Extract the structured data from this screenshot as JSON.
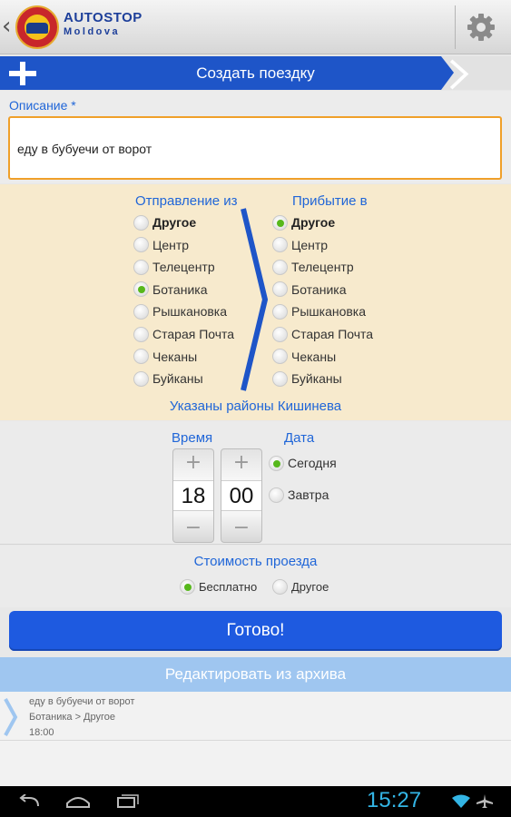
{
  "header": {
    "brand_line1": "AUTOSTOP",
    "brand_line2": "Moldova",
    "back_icon": "chevron-left-icon",
    "settings_icon": "gear-icon"
  },
  "create": {
    "title": "Создать поездку",
    "icon": "plus-icon"
  },
  "description": {
    "label": "Описание *",
    "value": "еду в бубуечи от ворот"
  },
  "departure": {
    "heading": "Отправление из",
    "selected": "Ботаника",
    "options": [
      "Другое",
      "Центр",
      "Телецентр",
      "Ботаника",
      "Рышкановка",
      "Старая Почта",
      "Чеканы",
      "Буйканы"
    ]
  },
  "arrival": {
    "heading": "Прибытие в",
    "selected": "Другое",
    "options": [
      "Другое",
      "Центр",
      "Телецентр",
      "Ботаника",
      "Рышкановка",
      "Старая Почта",
      "Чеканы",
      "Буйканы"
    ]
  },
  "districts_note": "Указаны районы Кишинева",
  "time": {
    "label": "Время",
    "hours": "18",
    "minutes": "00",
    "plus": "+",
    "minus": "−"
  },
  "date": {
    "label": "Дата",
    "options": [
      "Сегодня",
      "Завтра"
    ],
    "selected": "Сегодня"
  },
  "cost": {
    "label": "Стоимость проезда",
    "options": [
      "Бесплатно",
      "Другое"
    ],
    "selected": "Бесплатно"
  },
  "done_label": "Готово!",
  "archive": {
    "title": "Редактировать из архива",
    "items": [
      {
        "description": "еду в бубуечи от ворот",
        "route": "Ботаника > Другое",
        "time": "18:00"
      }
    ]
  },
  "status": {
    "clock": "15:27",
    "colors": {
      "accent": "#1e55c8",
      "selected_radio": "#57b81c",
      "clock": "#33b5e5"
    }
  }
}
